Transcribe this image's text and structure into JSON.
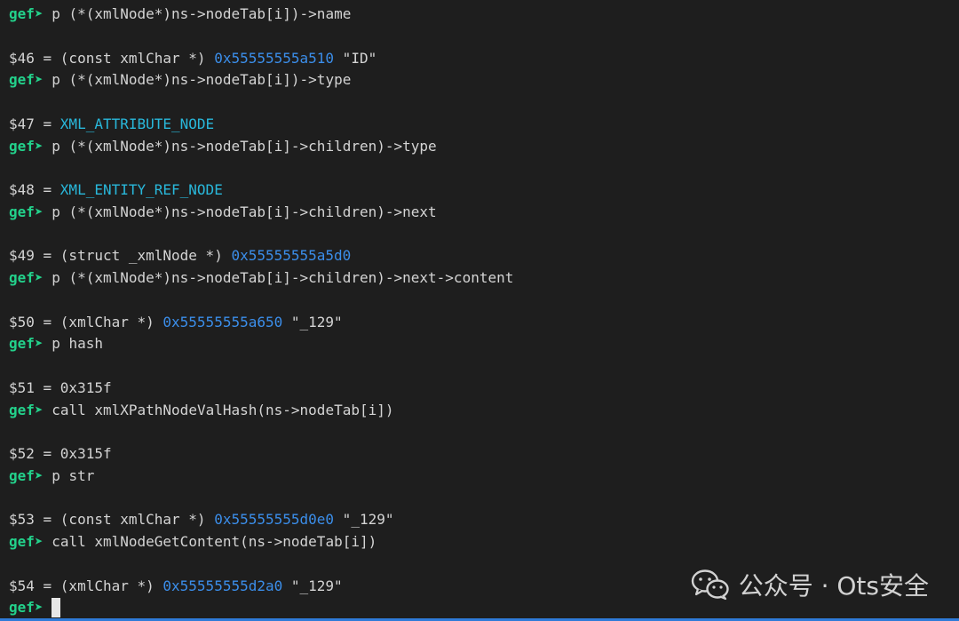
{
  "prompt": "gef",
  "prompt_arrow": "➤",
  "lines": [
    {
      "type": "cmd",
      "text": "p (*(xmlNode*)ns->nodeTab[i])->name"
    },
    {
      "type": "blank"
    },
    {
      "type": "out",
      "parts": [
        {
          "c": "plain",
          "t": "$46 = (const xmlChar *) "
        },
        {
          "c": "addr",
          "t": "0x55555555a510"
        },
        {
          "c": "plain",
          "t": " \"ID\""
        }
      ]
    },
    {
      "type": "cmd",
      "text": "p (*(xmlNode*)ns->nodeTab[i])->type"
    },
    {
      "type": "blank"
    },
    {
      "type": "out",
      "parts": [
        {
          "c": "plain",
          "t": "$47 = "
        },
        {
          "c": "enum",
          "t": "XML_ATTRIBUTE_NODE"
        }
      ]
    },
    {
      "type": "cmd",
      "text": "p (*(xmlNode*)ns->nodeTab[i]->children)->type"
    },
    {
      "type": "blank"
    },
    {
      "type": "out",
      "parts": [
        {
          "c": "plain",
          "t": "$48 = "
        },
        {
          "c": "enum",
          "t": "XML_ENTITY_REF_NODE"
        }
      ]
    },
    {
      "type": "cmd",
      "text": "p (*(xmlNode*)ns->nodeTab[i]->children)->next"
    },
    {
      "type": "blank"
    },
    {
      "type": "out",
      "parts": [
        {
          "c": "plain",
          "t": "$49 = (struct _xmlNode *) "
        },
        {
          "c": "addr",
          "t": "0x55555555a5d0"
        }
      ]
    },
    {
      "type": "cmd",
      "text": "p (*(xmlNode*)ns->nodeTab[i]->children)->next->content"
    },
    {
      "type": "blank"
    },
    {
      "type": "out",
      "parts": [
        {
          "c": "plain",
          "t": "$50 = (xmlChar *) "
        },
        {
          "c": "addr",
          "t": "0x55555555a650"
        },
        {
          "c": "plain",
          "t": " \"_129\""
        }
      ]
    },
    {
      "type": "cmd",
      "text": "p hash"
    },
    {
      "type": "blank"
    },
    {
      "type": "out",
      "parts": [
        {
          "c": "plain",
          "t": "$51 = 0x315f"
        }
      ]
    },
    {
      "type": "cmd",
      "text": "call xmlXPathNodeValHash(ns->nodeTab[i])"
    },
    {
      "type": "blank"
    },
    {
      "type": "out",
      "parts": [
        {
          "c": "plain",
          "t": "$52 = 0x315f"
        }
      ]
    },
    {
      "type": "cmd",
      "text": "p str"
    },
    {
      "type": "blank"
    },
    {
      "type": "out",
      "parts": [
        {
          "c": "plain",
          "t": "$53 = (const xmlChar *) "
        },
        {
          "c": "addr",
          "t": "0x55555555d0e0"
        },
        {
          "c": "plain",
          "t": " \"_129\""
        }
      ]
    },
    {
      "type": "cmd",
      "text": "call xmlNodeGetContent(ns->nodeTab[i])"
    },
    {
      "type": "blank"
    },
    {
      "type": "out",
      "parts": [
        {
          "c": "plain",
          "t": "$54 = (xmlChar *) "
        },
        {
          "c": "addr",
          "t": "0x55555555d2a0"
        },
        {
          "c": "plain",
          "t": " \"_129\""
        }
      ]
    },
    {
      "type": "input",
      "text": ""
    }
  ],
  "watermark": {
    "icon": "wechat-icon",
    "text": "公众号 · Ots安全"
  },
  "colors": {
    "background": "#1e1e1e",
    "prompt": "#23d18b",
    "address": "#3b8eea",
    "enum": "#29b8db",
    "text": "#d4d4d4",
    "bottom_bar": "#2f7bd8"
  }
}
